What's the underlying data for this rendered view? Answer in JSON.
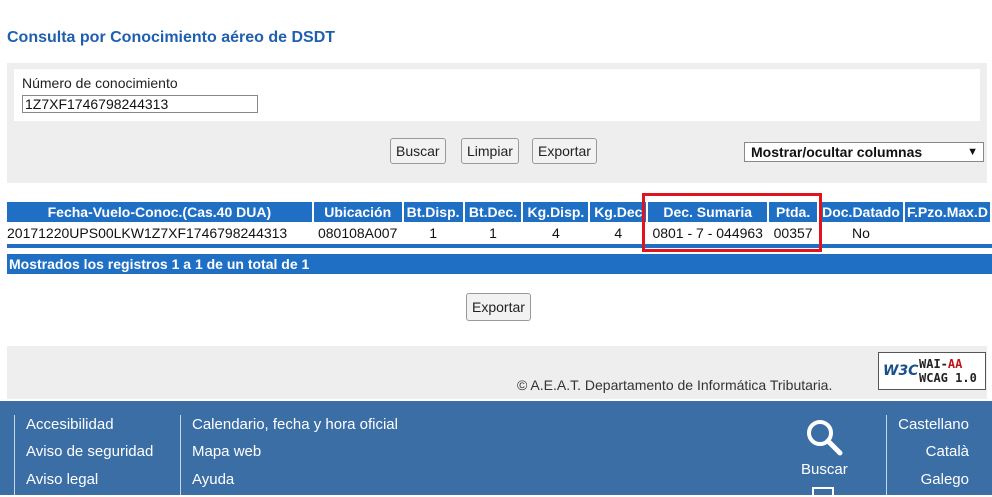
{
  "page": {
    "title": "Consulta por Conocimiento aéreo de DSDT"
  },
  "form": {
    "label": "Número de conocimiento",
    "value": "1Z7XF1746798244313",
    "buttons": {
      "search": "Buscar",
      "clear": "Limpiar",
      "export": "Exportar"
    },
    "columns_select": "Mostrar/ocultar columnas"
  },
  "table": {
    "headers": [
      "Fecha-Vuelo-Conoc.(Cas.40 DUA)",
      "Ubicación",
      "Bt.Disp.",
      "Bt.Dec.",
      "Kg.Disp.",
      "Kg.Dec",
      "Dec. Sumaria",
      "Ptda.",
      "Doc.Datado",
      "F.Pzo.Max.D"
    ],
    "rows": [
      [
        "20171220UPS00LKW1Z7XF1746798244313",
        "080108A007",
        "1",
        "1",
        "4",
        "4",
        "0801 - 7 - 044963",
        "00357",
        "No",
        ""
      ]
    ],
    "summary": "Mostrados los registros 1 a 1 de un total de 1"
  },
  "export_bottom": "Exportar",
  "footer": {
    "copyright": "© A.E.A.T. Departamento de Informática Tributaria.",
    "badge": {
      "logo": "W3C",
      "line1_prefix": "WAI-",
      "line1_level": "AA",
      "line2": "WCAG 1.0"
    }
  },
  "bottom_nav": {
    "col1": [
      "Accesibilidad",
      "Aviso de seguridad",
      "Aviso legal"
    ],
    "col2": [
      "Calendario, fecha y hora oficial",
      "Mapa web",
      "Ayuda"
    ],
    "search": "Buscar",
    "languages": [
      "Castellano",
      "Català",
      "Galego"
    ]
  },
  "colors": {
    "title": "#1f5fb0",
    "table_header": "#1f6fc5",
    "highlight": "#e0141e",
    "bottom_bar": "#3a6ea5"
  }
}
